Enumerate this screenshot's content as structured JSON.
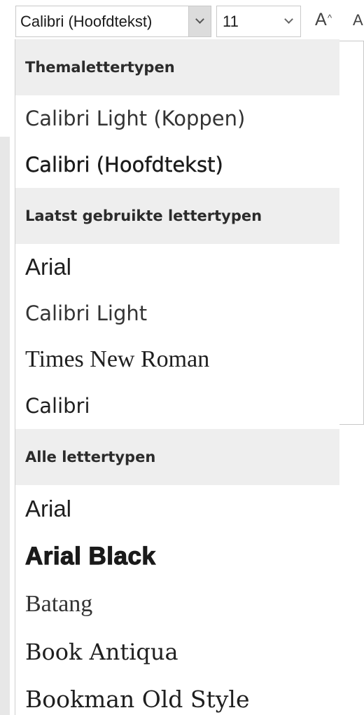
{
  "toolbar": {
    "font_name": "Calibri (Hoofdtekst)",
    "font_size": "11",
    "grow_font_glyph": "A",
    "grow_font_caret": "^",
    "shrink_font_glyph": "A"
  },
  "dropdown": {
    "sections": [
      {
        "header": "Themalettertypen",
        "items": [
          "Calibri Light (Koppen)",
          "Calibri (Hoofdtekst)"
        ]
      },
      {
        "header": "Laatst gebruikte lettertypen",
        "items": [
          "Arial",
          "Calibri Light",
          "Times New Roman",
          "Calibri"
        ]
      },
      {
        "header": "Alle lettertypen",
        "items": [
          "Arial",
          "Arial Black",
          "Batang",
          "Book Antiqua",
          "Bookman Old Style"
        ]
      }
    ]
  },
  "icons": {
    "dropdown_toggle": "chevron-down-icon",
    "grow_font": "grow-font-icon",
    "shrink_font": "shrink-font-icon"
  },
  "colors": {
    "section_header_bg": "#eeeeee",
    "toggle_bg": "#dcdcdc",
    "border": "#c8c8c8"
  }
}
